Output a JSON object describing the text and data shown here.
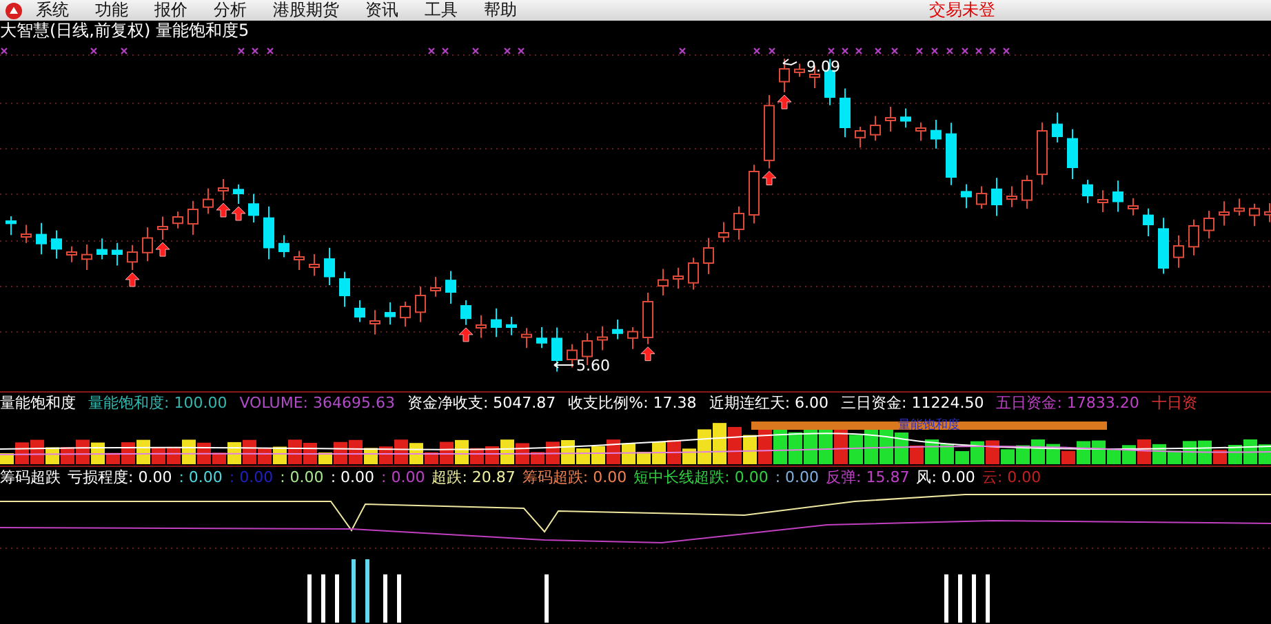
{
  "menu": {
    "items": [
      "系统",
      "功能",
      "报价",
      "分析",
      "港股期货",
      "资讯",
      "工具",
      "帮助"
    ],
    "status": "交易未登"
  },
  "title": "大智慧(日线,前复权) 量能饱和度5",
  "price_chart": {
    "high_label": "9.09",
    "low_label": "5.60"
  },
  "indicator_header": [
    {
      "text": "量能饱和度",
      "color": "#ffffff"
    },
    {
      "text": "量能饱和度: 100.00",
      "color": "#33b8b0"
    },
    {
      "text": "VOLUME: 364695.63",
      "color": "#b04cc8"
    },
    {
      "text": "资金净收支: 5047.87",
      "color": "#ffffff"
    },
    {
      "text": "收支比例%: 17.38",
      "color": "#ffffff"
    },
    {
      "text": "近期连红天: 6.00",
      "color": "#ffffff"
    },
    {
      "text": "三日资金: 11224.50",
      "color": "#ffffff"
    },
    {
      "text": "五日资金: 17833.20",
      "color": "#c040c8"
    },
    {
      "text": "十日资",
      "color": "#e03030"
    }
  ],
  "volume_panel": {
    "bar_label": "量能饱和度"
  },
  "indicator_readout": [
    {
      "text": "筹码超跌",
      "color": "#ffffff"
    },
    {
      "text": "亏损程度: 0.00",
      "color": "#ffffff"
    },
    {
      "text": ": 0.00",
      "color": "#4fd8e0"
    },
    {
      "text": ": 0.00",
      "color": "#2020c0"
    },
    {
      "text": ": 0.00",
      "color": "#a8e890"
    },
    {
      "text": ": 0.00",
      "color": "#ffffff"
    },
    {
      "text": ": 0.00",
      "color": "#c040c8"
    },
    {
      "text": "超跌: 20.87",
      "color": "#f0f0a0"
    },
    {
      "text": "筹码超跌: 0.00",
      "color": "#f08050"
    },
    {
      "text": "短中长线超跌: 0.00",
      "color": "#30d040"
    },
    {
      "text": ": 0.00",
      "color": "#80b0e0"
    },
    {
      "text": "反弹: 15.87",
      "color": "#c040c8"
    },
    {
      "text": "风: 0.00",
      "color": "#ffffff"
    },
    {
      "text": "云: 0.00",
      "color": "#c02020"
    }
  ]
}
